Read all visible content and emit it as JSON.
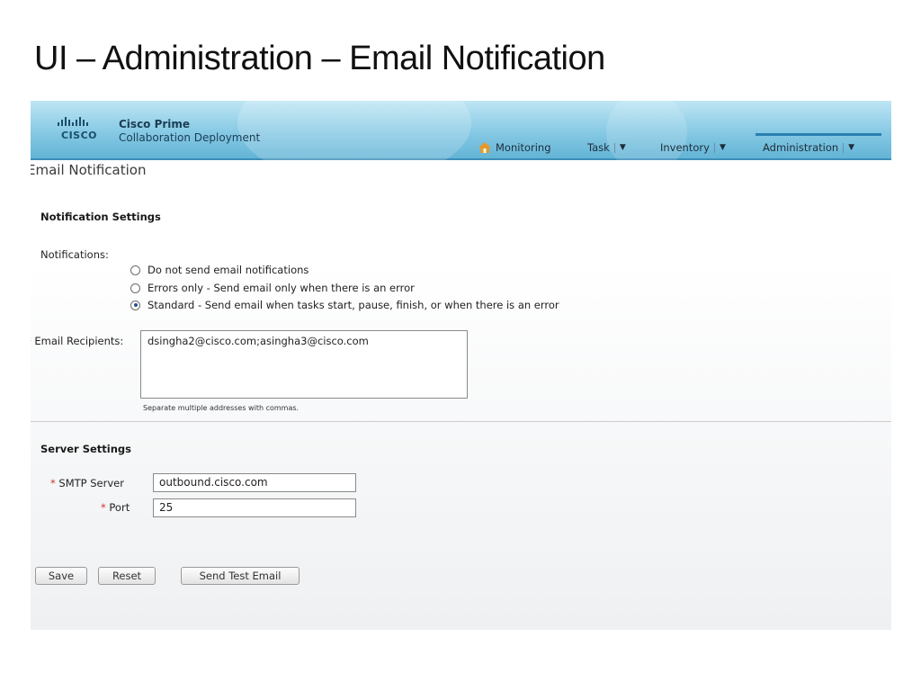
{
  "slide": {
    "title": "UI – Administration – Email Notification"
  },
  "app": {
    "logo_word": "CISCO",
    "product_name": "Cisco Prime",
    "product_sub": "Collaboration Deployment"
  },
  "nav": {
    "items": [
      {
        "label": "Monitoring",
        "icon": "home-icon",
        "has_menu": false
      },
      {
        "label": "Task",
        "has_menu": true
      },
      {
        "label": "Inventory",
        "has_menu": true
      },
      {
        "label": "Administration",
        "has_menu": true,
        "active": true
      }
    ],
    "menu_arrow": "▼"
  },
  "page": {
    "title": "Email Notification",
    "notification_section": "Notification Settings",
    "notifications_label": "Notifications:",
    "options": [
      {
        "label": "Do not send email notifications",
        "checked": false
      },
      {
        "label": "Errors only - Send email only when there is an error",
        "checked": false
      },
      {
        "label": "Standard - Send email when tasks start, pause, finish, or when there is an error",
        "checked": true
      }
    ],
    "required_mark": "*",
    "recipients_label": "Email Recipients:",
    "recipients_value": "dsingha2@cisco.com;asingha3@cisco.com",
    "recipients_hint": "Separate multiple addresses with commas.",
    "server_section": "Server Settings",
    "smtp_label": "SMTP Server",
    "smtp_value": "outbound.cisco.com",
    "port_label": "Port",
    "port_value": "25"
  },
  "buttons": {
    "save": "Save",
    "reset": "Reset",
    "send_test": "Send Test Email"
  },
  "colors": {
    "header_top": "#bfe6f4",
    "header_bottom": "#63b4d6",
    "required": "#d0342c",
    "brand_text": "#1b4e6b"
  }
}
